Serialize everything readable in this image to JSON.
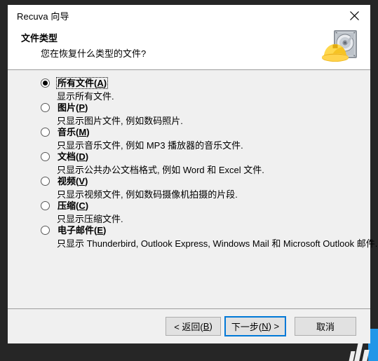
{
  "window": {
    "title": "Recuva 向导",
    "close_icon": "close-icon"
  },
  "header": {
    "title": "文件类型",
    "subtitle": "您在恢复什么类型的文件?",
    "logo_icon": "recuva-harddrive-hardhat-icon"
  },
  "options": [
    {
      "label_pre": "所有文件(",
      "mnemonic": "A",
      "label_post": ")",
      "desc": "显示所有文件.",
      "selected": true
    },
    {
      "label_pre": "图片(",
      "mnemonic": "P",
      "label_post": ")",
      "desc": "只显示图片文件, 例如数码照片.",
      "selected": false
    },
    {
      "label_pre": "音乐(",
      "mnemonic": "M",
      "label_post": ")",
      "desc": "只显示音乐文件, 例如 MP3 播放器的音乐文件.",
      "selected": false
    },
    {
      "label_pre": "文档(",
      "mnemonic": "D",
      "label_post": ")",
      "desc": "只显示公共办公文档格式, 例如 Word 和 Excel 文件.",
      "selected": false
    },
    {
      "label_pre": "视频(",
      "mnemonic": "V",
      "label_post": ")",
      "desc": "只显示视频文件, 例如数码摄像机拍摄的片段.",
      "selected": false
    },
    {
      "label_pre": "压缩(",
      "mnemonic": "C",
      "label_post": ")",
      "desc": "只显示压缩文件.",
      "selected": false
    },
    {
      "label_pre": "电子邮件(",
      "mnemonic": "E",
      "label_post": ")",
      "desc": "只显示 Thunderbird, Outlook Express,  Windows Mail 和 Microsoft Outlook 邮件.",
      "selected": false
    }
  ],
  "footer": {
    "back": {
      "pre": "< 返回(",
      "mnemonic": "B",
      "post": ")"
    },
    "next": {
      "pre": "下一步(",
      "mnemonic": "N",
      "post": ") >",
      "focused": true
    },
    "cancel": {
      "pre": "取消",
      "mnemonic": "",
      "post": ""
    }
  },
  "colors": {
    "accent": "#0078d7",
    "dialog_bg": "#f0f0f0",
    "header_bg": "#ffffff",
    "desktop_bg": "#262626"
  }
}
